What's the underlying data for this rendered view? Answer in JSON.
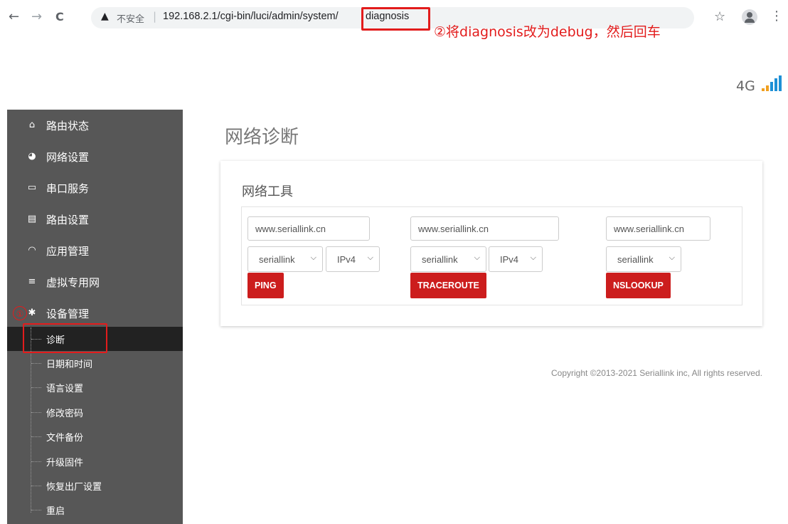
{
  "browser": {
    "back_icon": "←",
    "forward_icon": "→",
    "reload_icon": "C",
    "warn_icon": "▲",
    "insecure_label": "不安全",
    "separator": "|",
    "url_base": "192.168.2.1/cgi-bin/luci/admin/system/",
    "url_tail": "diagnosis",
    "star_icon": "☆",
    "menu_icon": "⋮"
  },
  "annotations": {
    "step1_marker": "①",
    "step2_text": "②将diagnosis改为debug，然后回车",
    "highlight_color": "#e21c1c"
  },
  "header": {
    "network_label": "4G",
    "signal_colors": [
      "#f0a020",
      "#1e90d6"
    ]
  },
  "sidebar": {
    "items": [
      {
        "label": "路由状态",
        "icon": "home-icon",
        "glyph": "⌂"
      },
      {
        "label": "网络设置",
        "icon": "globe-icon",
        "glyph": "◕"
      },
      {
        "label": "串口服务",
        "icon": "serial-port-icon",
        "glyph": "▭"
      },
      {
        "label": "路由设置",
        "icon": "calendar-icon",
        "glyph": "▤"
      },
      {
        "label": "应用管理",
        "icon": "gauge-icon",
        "glyph": "◠"
      },
      {
        "label": "虚拟专用网",
        "icon": "list-icon",
        "glyph": "≡"
      },
      {
        "label": "设备管理",
        "icon": "gears-icon",
        "glyph": "✱"
      }
    ],
    "subitems": [
      {
        "label": "诊断",
        "active": true
      },
      {
        "label": "日期和时间"
      },
      {
        "label": "语言设置"
      },
      {
        "label": "修改密码"
      },
      {
        "label": "文件备份"
      },
      {
        "label": "升级固件"
      },
      {
        "label": "恢复出厂设置"
      },
      {
        "label": "重启"
      }
    ]
  },
  "main": {
    "page_title": "网络诊断",
    "card_title": "网络工具",
    "tools": {
      "ping": {
        "host": "www.seriallink.cn",
        "iface": "seriallink",
        "proto": "IPv4",
        "button": "PING"
      },
      "traceroute": {
        "host": "www.seriallink.cn",
        "iface": "seriallink",
        "proto": "IPv4",
        "button": "TRACEROUTE"
      },
      "nslookup": {
        "host": "www.seriallink.cn",
        "iface": "seriallink",
        "button": "NSLOOKUP"
      }
    }
  },
  "footer": {
    "copyright": "Copyright ©2013-2021 Seriallink inc, All rights reserved."
  },
  "colors": {
    "sidebar_bg": "#575757",
    "active_bg": "#222222",
    "button_red": "#cc1d1d"
  }
}
